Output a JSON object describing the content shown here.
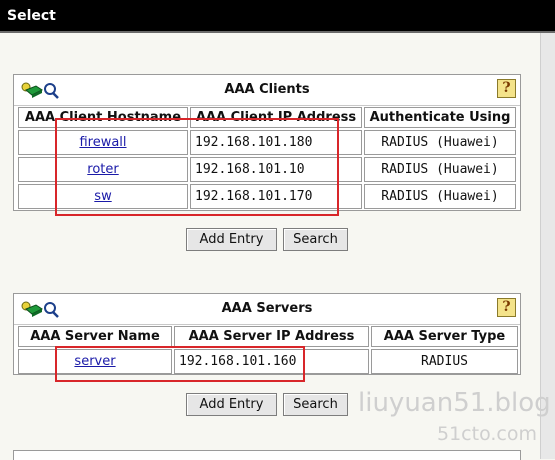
{
  "window": {
    "title": "Select"
  },
  "clients_panel": {
    "title": "AAA Clients",
    "columns": [
      "AAA Client Hostname",
      "AAA Client IP Address",
      "Authenticate Using"
    ],
    "rows": [
      {
        "hostname": "firewall",
        "ip": "192.168.101.180",
        "auth": "RADIUS (Huawei)"
      },
      {
        "hostname": "roter",
        "ip": "192.168.101.10",
        "auth": "RADIUS (Huawei)"
      },
      {
        "hostname": "sw",
        "ip": "192.168.101.170",
        "auth": "RADIUS (Huawei)"
      }
    ],
    "add_label": "Add Entry",
    "search_label": "Search"
  },
  "servers_panel": {
    "title": "AAA Servers",
    "columns": [
      "AAA Server Name",
      "AAA Server IP Address",
      "AAA Server Type"
    ],
    "rows": [
      {
        "name": "server",
        "ip": "192.168.101.160",
        "type": "RADIUS"
      }
    ],
    "add_label": "Add Entry",
    "search_label": "Search"
  },
  "help_glyph": "?",
  "watermark": {
    "line1": "liuyuan51.blog",
    "line2": "51cto.com"
  },
  "colors": {
    "link": "#1a1aa8",
    "annotation": "#d8262a",
    "titlebar": "#000000"
  }
}
